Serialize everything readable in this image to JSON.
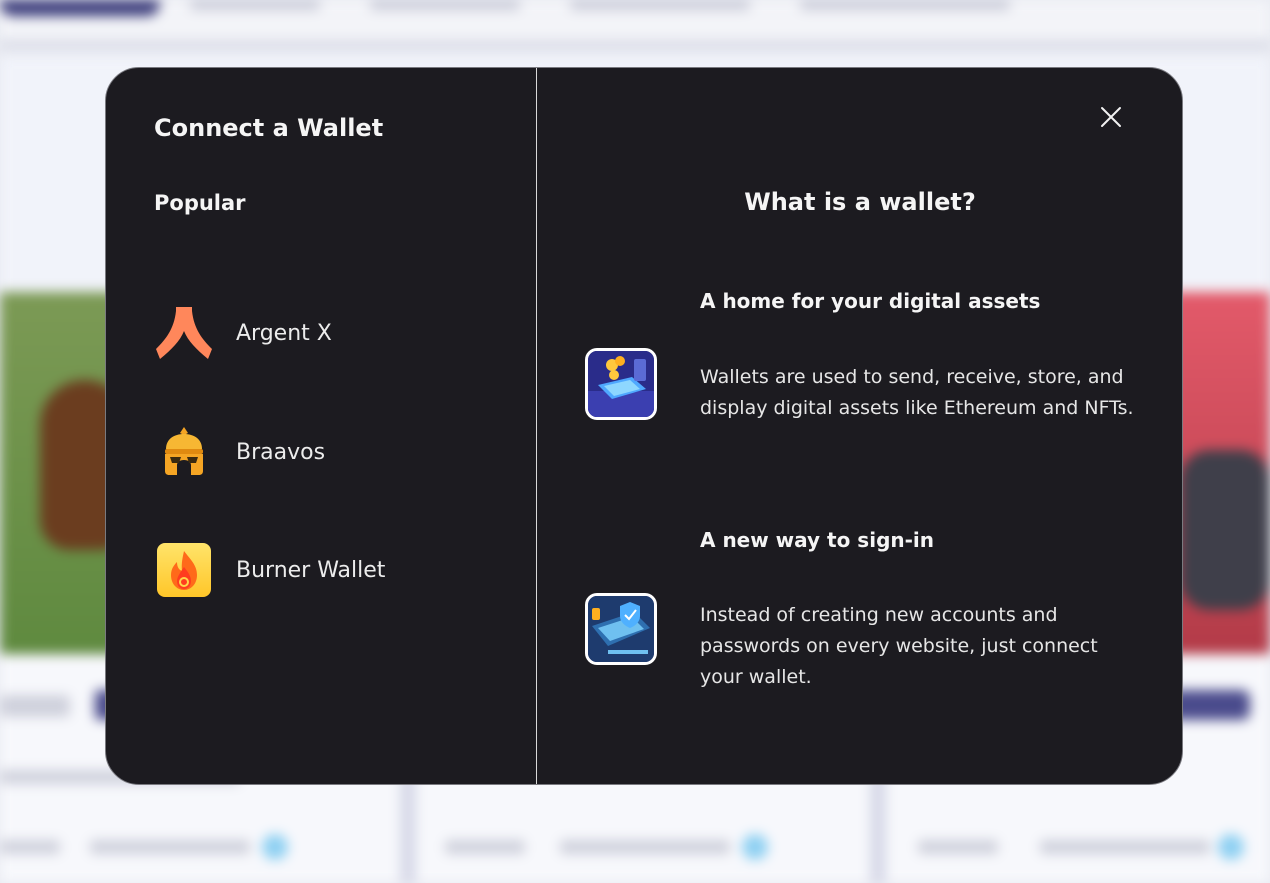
{
  "modal": {
    "title": "Connect a Wallet",
    "section_label": "Popular",
    "wallets": [
      {
        "name": "Argent X",
        "icon": "argent-x-logo"
      },
      {
        "name": "Braavos",
        "icon": "braavos-helmet-logo"
      },
      {
        "name": "Burner Wallet",
        "icon": "burner-flame-logo"
      }
    ],
    "info": {
      "title": "What is a wallet?",
      "features": [
        {
          "title": "A home for your digital assets",
          "description": "Wallets are used to send, receive, store, and display digital assets like Ethereum and NFTs.",
          "icon": "digital-assets-illustration"
        },
        {
          "title": "A new way to sign-in",
          "description": "Instead of creating new accounts and passwords on every website, just connect your wallet.",
          "icon": "secure-sign-in-illustration"
        }
      ]
    },
    "close_icon": "close-icon"
  },
  "colors": {
    "modal_bg": "#1c1b20",
    "argent": "#ff875b",
    "braavos": "#f5a524",
    "burner": "#ffd54a"
  }
}
